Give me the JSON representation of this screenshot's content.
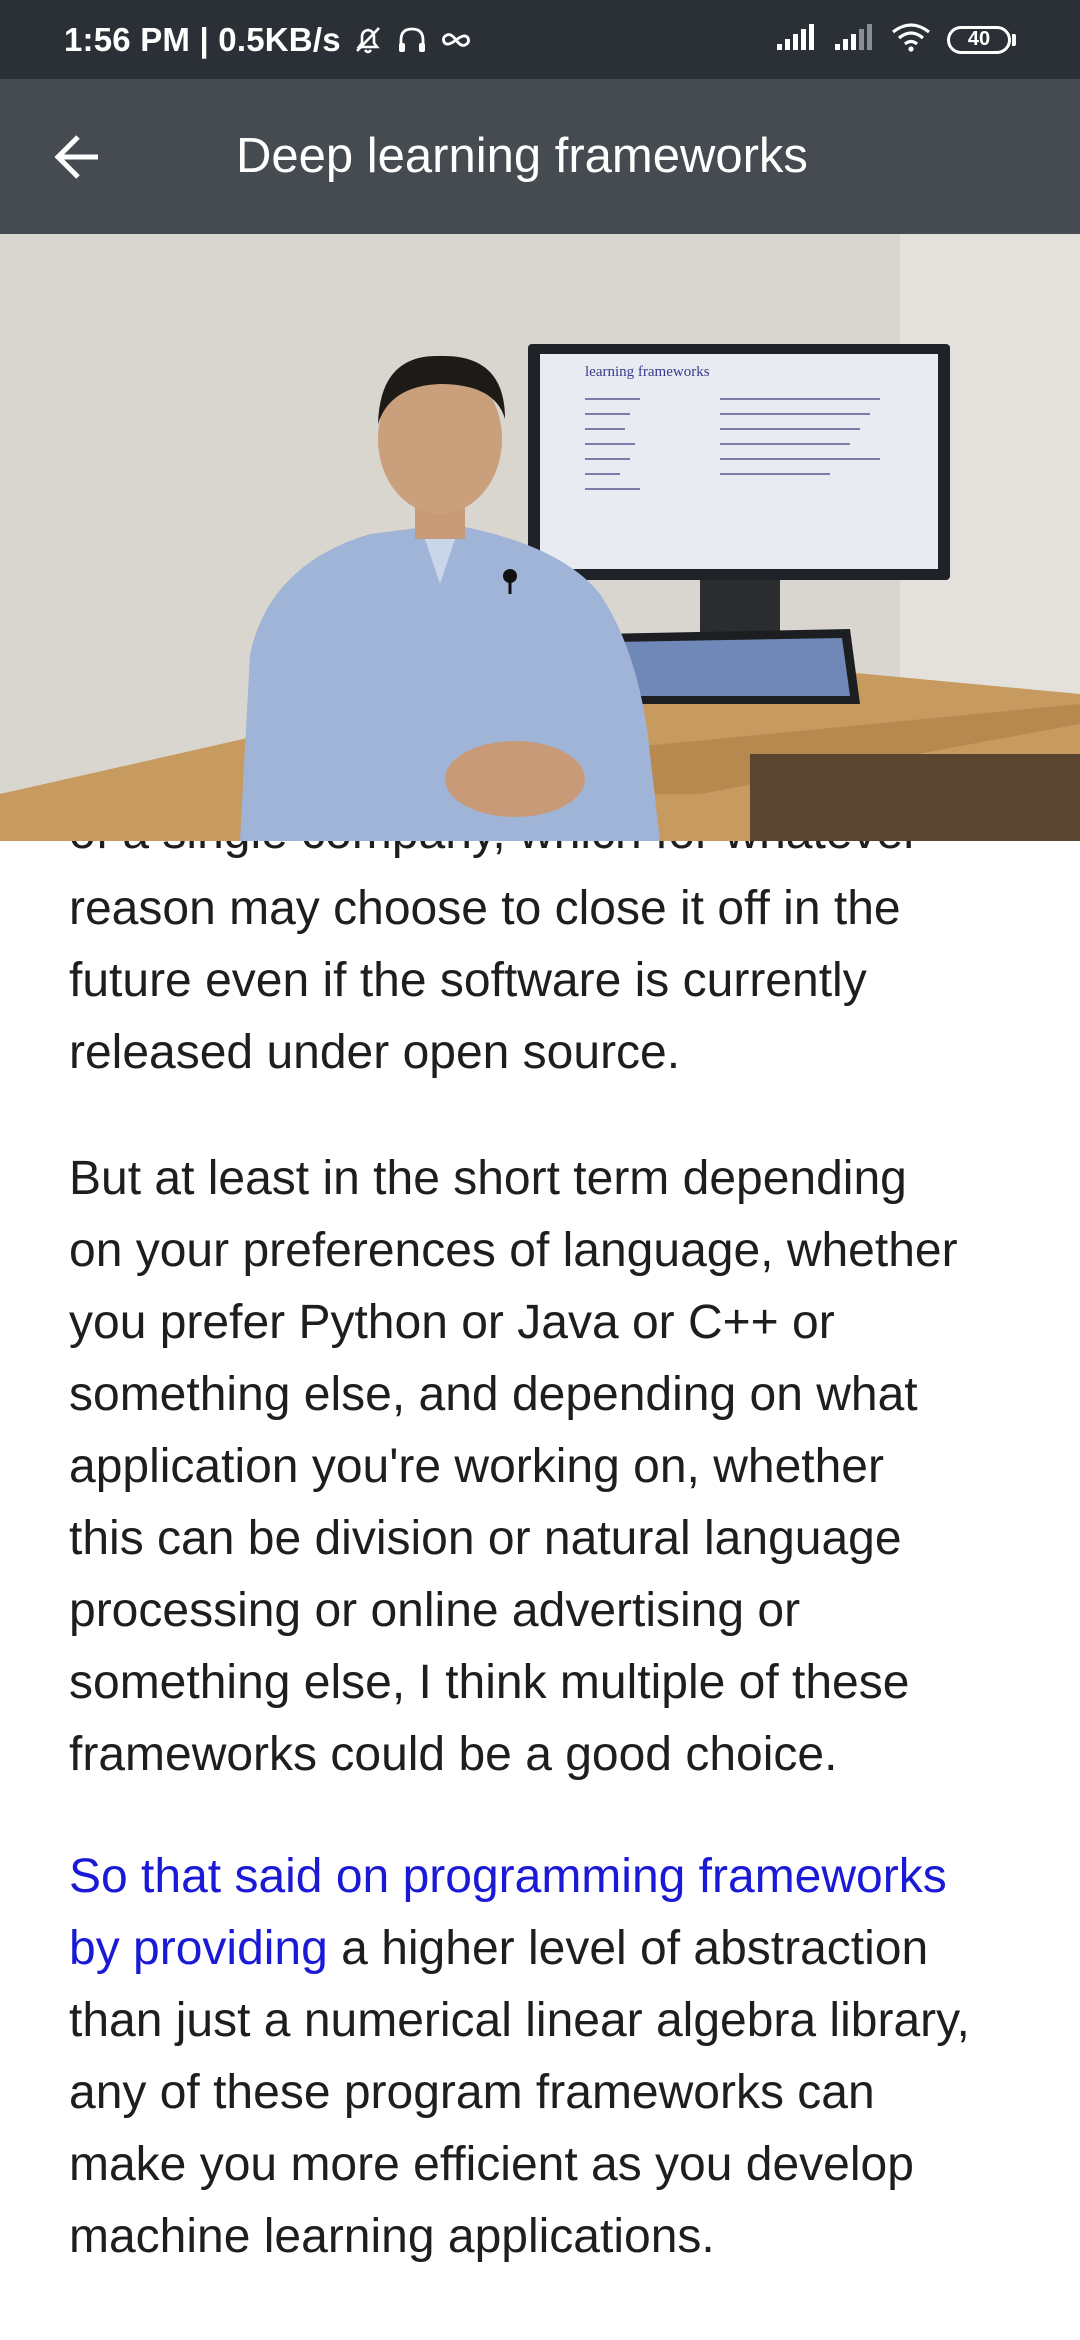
{
  "status_bar": {
    "time_speed": "1:56 PM | 0.5KB/s",
    "battery_level": "40",
    "icons": [
      "mute-alarm-icon",
      "headset-icon",
      "infinity-icon",
      "signal-icon",
      "signal-icon",
      "wifi-icon",
      "battery-icon"
    ]
  },
  "app_bar": {
    "title": "Deep learning frameworks",
    "back_icon": "arrow-left-icon"
  },
  "video": {
    "slide_title": "learning frameworks",
    "colors": {
      "wall": "#d9d5cf",
      "shirt": "#9fb4d6",
      "desk": "#c79a60",
      "monitor_frame": "#1f2227"
    }
  },
  "transcript": {
    "partial_line": "of a single company, which for whatever",
    "paragraphs": [
      {
        "lines": [
          "reason may choose to close it off in the",
          "future even if the software is currently",
          "released under open source."
        ]
      },
      {
        "lines": [
          "But at least in the short term depending",
          "on your preferences of language, whether",
          "you prefer Python or Java or C++ or",
          "something else, and depending on what",
          "application you're working on, whether",
          "this can be division or natural language",
          "processing or online advertising or",
          "something else, I think multiple of these",
          "frameworks could be a good choice."
        ]
      },
      {
        "highlighted_line1": "So that said on programming frameworks",
        "highlighted_line2_part": "by providing",
        "line2_rest": " a higher level of abstraction",
        "lines": [
          "than just a numerical linear algebra library,",
          "any of these program frameworks can",
          "make you more efficient as you develop",
          "machine learning applications."
        ]
      }
    ],
    "colors": {
      "text": "#1e1e1e",
      "highlight": "#1a1ad6"
    }
  }
}
